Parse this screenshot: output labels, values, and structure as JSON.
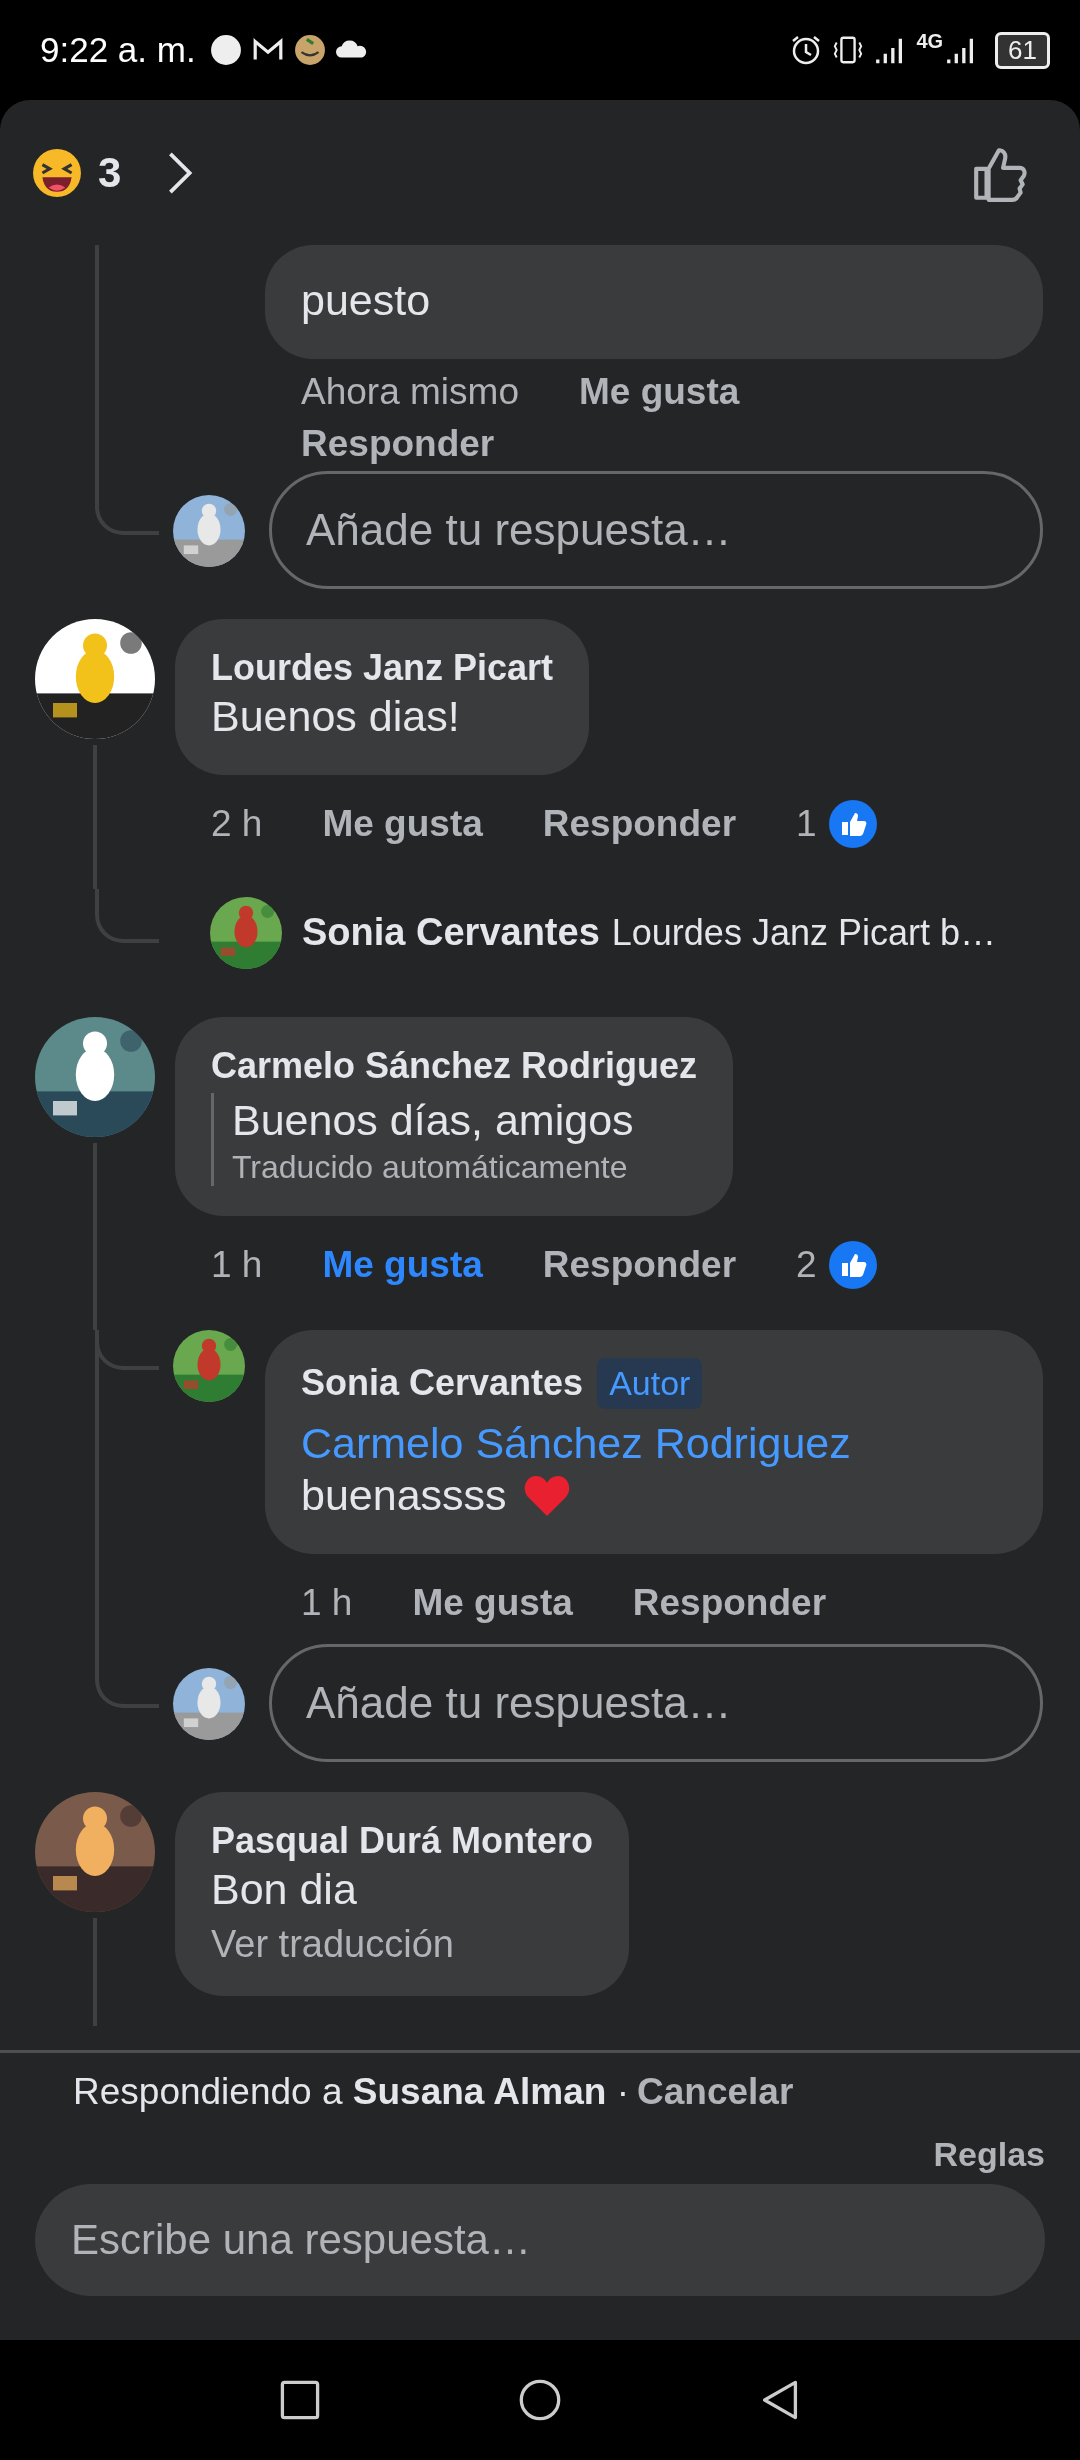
{
  "status_bar": {
    "time": "9:22 a. m.",
    "network": "4G",
    "battery": "61"
  },
  "header": {
    "reaction_count": "3"
  },
  "thread_tail": {
    "replies": [
      {
        "text": "puesto",
        "time": "Ahora mismo",
        "like_label": "Me gusta",
        "reply_label": "Responder",
        "liked": false
      }
    ],
    "reply_field": {
      "placeholder": "Añade tu respuesta…"
    }
  },
  "comments": [
    {
      "author": "Lourdes Janz Picart",
      "text": "Buenos dias!",
      "time": "2 h",
      "like_label": "Me gusta",
      "reply_label": "Responder",
      "liked": false,
      "reaction_count": "1",
      "reply_preview": {
        "author": "Sonia Cervantes",
        "text": "Lourdes Janz Picart b…"
      }
    },
    {
      "author": "Carmelo Sánchez Rodriguez",
      "text": "Buenos días, amigos",
      "translation_note": "Traducido automáticamente",
      "time": "1 h",
      "like_label": "Me gusta",
      "reply_label": "Responder",
      "liked": true,
      "reaction_count": "2",
      "replies": [
        {
          "author": "Sonia Cervantes",
          "badge": "Autor",
          "mention": "Carmelo Sánchez Rodriguez",
          "text": "buenassss",
          "time": "1 h",
          "like_label": "Me gusta",
          "reply_label": "Responder",
          "liked": false
        }
      ],
      "reply_field": {
        "placeholder": "Añade tu respuesta…"
      }
    },
    {
      "author": "Pasqual Durá Montero",
      "text": "Bon dia",
      "translate_link": "Ver traducción",
      "thread_continues": true
    }
  ],
  "composer": {
    "replying": "Respondiendo a **Susana Alman** ·",
    "cancel": "Cancelar",
    "rules": "Reglas",
    "placeholder": "Escribe una respuesta…"
  }
}
